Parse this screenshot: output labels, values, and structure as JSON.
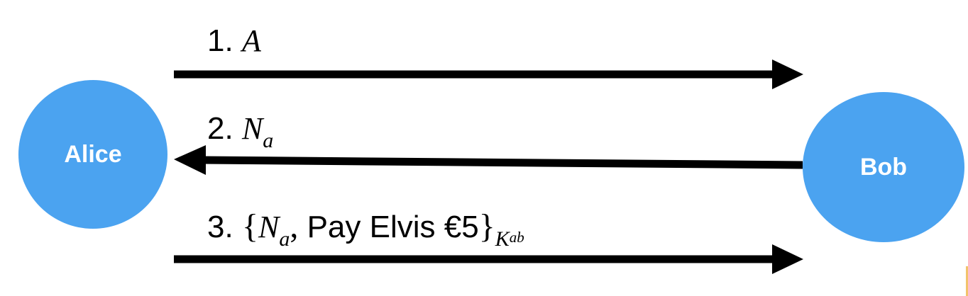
{
  "colors": {
    "node_fill": "#4ba3f0",
    "node_text": "#ffffff",
    "arrow": "#000000",
    "text": "#000000"
  },
  "nodes": {
    "alice": "Alice",
    "bob": "Bob"
  },
  "messages": [
    {
      "number": "1.",
      "term": "A",
      "direction": "Alice to Bob"
    },
    {
      "number": "2.",
      "term": "N",
      "term_sub": "a",
      "direction": "Bob to Alice"
    },
    {
      "number": "3.",
      "open_brace": "{",
      "term": "N",
      "term_sub": "a",
      "separator": ",",
      "payload": "Pay Elvis €5",
      "close_brace": "}",
      "key": "K",
      "key_sub": "ab",
      "direction": "Alice to Bob"
    }
  ]
}
